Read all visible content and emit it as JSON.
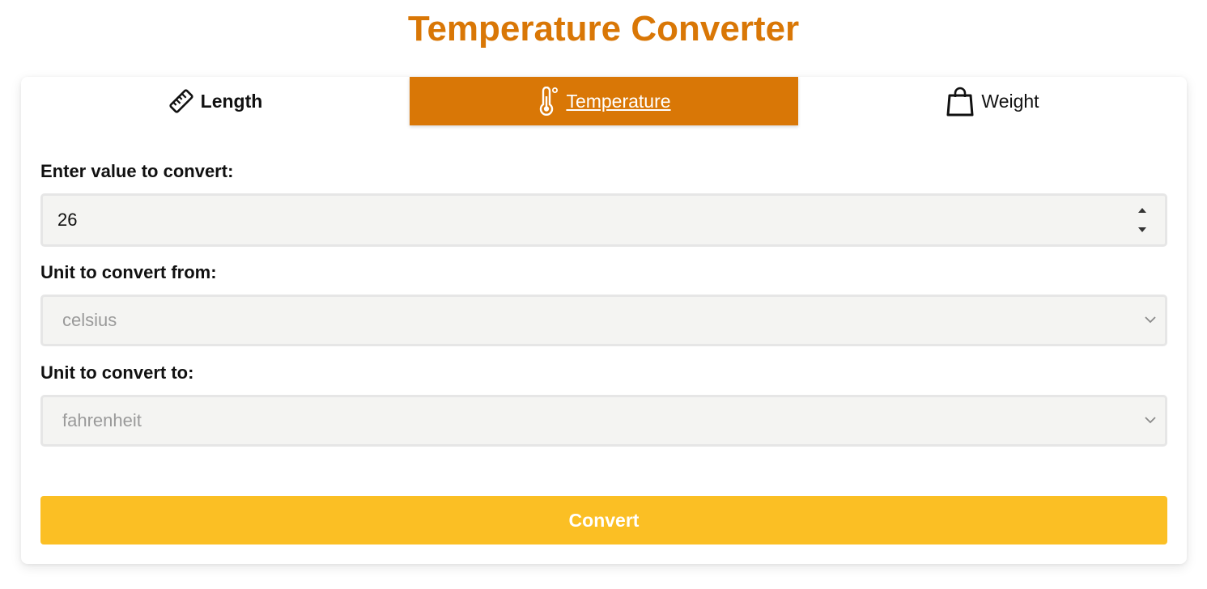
{
  "page": {
    "title": "Temperature Converter"
  },
  "tabs": [
    {
      "label": "Length",
      "icon": "ruler-icon",
      "active": false
    },
    {
      "label": "Temperature",
      "icon": "thermometer-icon",
      "active": true
    },
    {
      "label": "Weight",
      "icon": "shopping-bag-icon",
      "active": false
    }
  ],
  "form": {
    "value_label": "Enter value to convert:",
    "value": "26",
    "from_label": "Unit to convert from:",
    "from_selected": "celsius",
    "to_label": "Unit to convert to:",
    "to_selected": "fahrenheit",
    "convert_label": "Convert"
  },
  "colors": {
    "accent": "#d97706",
    "button": "#fbbf24",
    "field_bg": "#f4f4f2"
  }
}
